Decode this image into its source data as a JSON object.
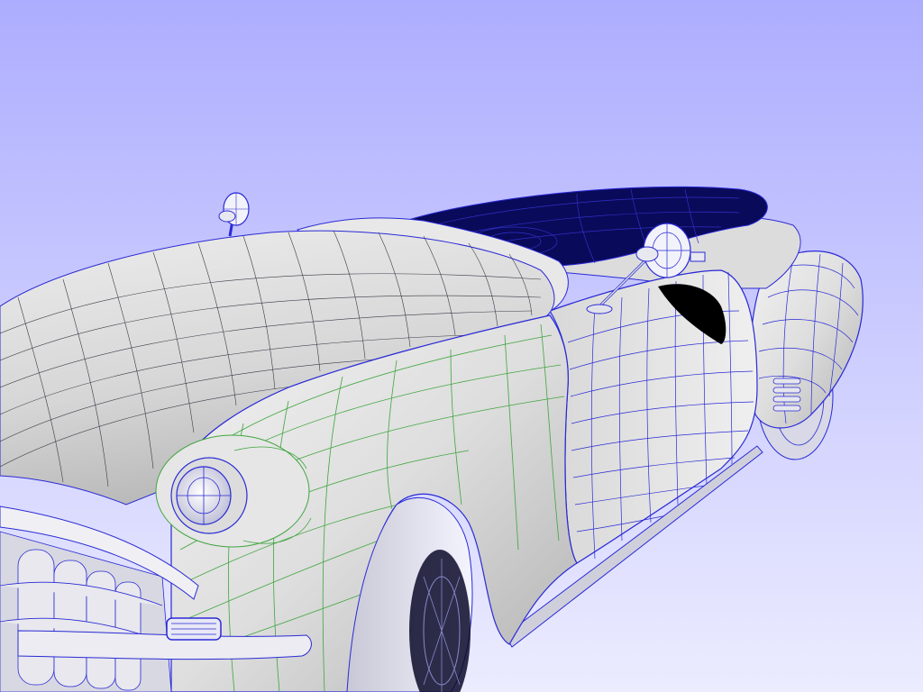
{
  "viewport": {
    "background_top": "#b0b0ff",
    "background_bottom": "#ececff"
  },
  "model": {
    "surface_color": "#e2e2e2",
    "shadow_color": "#9a9a9a",
    "isocurve_selected_color": "#2a2ad6",
    "isocurve_active_color": "#3fa53f",
    "isocurve_default_color": "#3a3a48",
    "interior_color": "#0a0a5a"
  }
}
